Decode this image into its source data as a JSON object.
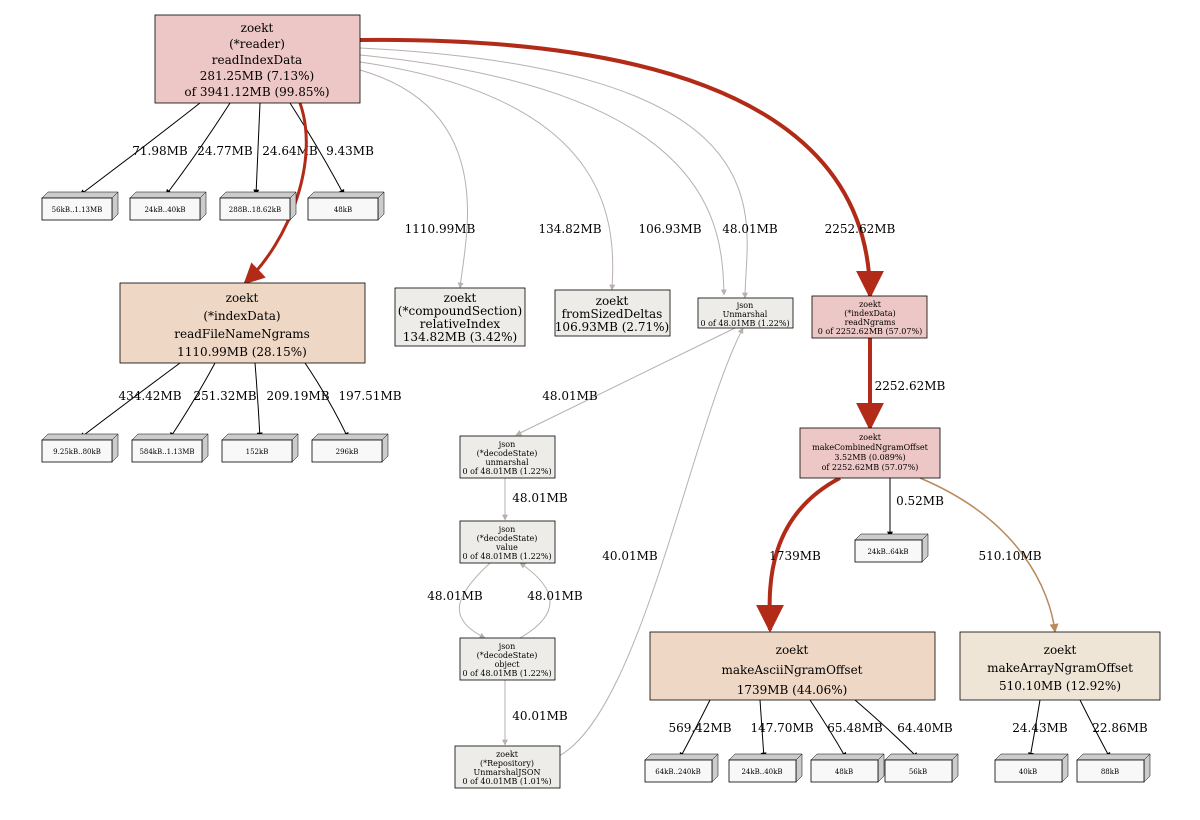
{
  "chart_data": {
    "type": "callgraph",
    "tool": "pprof",
    "root": "zoekt (*reader) readIndexData",
    "nodes": [
      {
        "id": "n1",
        "pkg": "zoekt",
        "func": "(*reader)",
        "name": "readIndexData",
        "self": "281.25MB",
        "self_pct": "7.13%",
        "cum": "3941.12MB",
        "cum_pct": "99.85%"
      },
      {
        "id": "n1a",
        "label": "56kB..1.13MB"
      },
      {
        "id": "n1b",
        "label": "24kB..40kB"
      },
      {
        "id": "n1c",
        "label": "288B..18.62kB"
      },
      {
        "id": "n1d",
        "label": "48kB"
      },
      {
        "id": "n2",
        "pkg": "zoekt",
        "func": "(*indexData)",
        "name": "readFileNameNgrams",
        "self": "1110.99MB",
        "self_pct": "28.15%"
      },
      {
        "id": "n2a",
        "label": "9.25kB..80kB"
      },
      {
        "id": "n2b",
        "label": "584kB..1.13MB"
      },
      {
        "id": "n2c",
        "label": "152kB"
      },
      {
        "id": "n2d",
        "label": "296kB"
      },
      {
        "id": "n3",
        "pkg": "zoekt",
        "func": "(*compoundSection)",
        "name": "relativeIndex",
        "self": "134.82MB",
        "self_pct": "3.42%"
      },
      {
        "id": "n4",
        "pkg": "zoekt",
        "name": "fromSizedDeltas",
        "self": "106.93MB",
        "self_pct": "2.71%"
      },
      {
        "id": "n5",
        "pkg": "json",
        "name": "Unmarshal",
        "cum": "48.01MB",
        "cum_pct": "1.22%",
        "self": "0"
      },
      {
        "id": "n6",
        "pkg": "zoekt",
        "func": "(*indexData)",
        "name": "readNgrams",
        "cum": "2252.62MB",
        "cum_pct": "57.07%",
        "self": "0"
      },
      {
        "id": "n7",
        "pkg": "json",
        "func": "(*decodeState)",
        "name": "unmarshal",
        "cum": "48.01MB",
        "cum_pct": "1.22%",
        "self": "0"
      },
      {
        "id": "n8",
        "pkg": "json",
        "func": "(*decodeState)",
        "name": "value",
        "cum": "48.01MB",
        "cum_pct": "1.22%",
        "self": "0"
      },
      {
        "id": "n9",
        "pkg": "json",
        "func": "(*decodeState)",
        "name": "object",
        "cum": "48.01MB",
        "cum_pct": "1.22%",
        "self": "0"
      },
      {
        "id": "n10",
        "pkg": "zoekt",
        "func": "(*Repository)",
        "name": "UnmarshalJSON",
        "cum": "40.01MB",
        "cum_pct": "1.01%",
        "self": "0"
      },
      {
        "id": "n11",
        "pkg": "zoekt",
        "name": "makeCombinedNgramOffset",
        "self": "3.52MB",
        "self_pct": "0.089%",
        "cum": "2252.62MB",
        "cum_pct": "57.07%"
      },
      {
        "id": "n11a",
        "label": "24kB..64kB"
      },
      {
        "id": "n12",
        "pkg": "zoekt",
        "name": "makeAsciiNgramOffset",
        "self": "1739MB",
        "self_pct": "44.06%"
      },
      {
        "id": "n12a",
        "label": "64kB..240kB"
      },
      {
        "id": "n12b",
        "label": "24kB..40kB"
      },
      {
        "id": "n12c",
        "label": "48kB"
      },
      {
        "id": "n12d",
        "label": "56kB"
      },
      {
        "id": "n13",
        "pkg": "zoekt",
        "name": "makeArrayNgramOffset",
        "self": "510.10MB",
        "self_pct": "12.92%"
      },
      {
        "id": "n13a",
        "label": "40kB"
      },
      {
        "id": "n13b",
        "label": "88kB"
      }
    ],
    "edges": [
      {
        "from": "n1",
        "to": "n1a",
        "w": "71.98MB"
      },
      {
        "from": "n1",
        "to": "n1b",
        "w": "24.77MB"
      },
      {
        "from": "n1",
        "to": "n1c",
        "w": "24.64MB"
      },
      {
        "from": "n1",
        "to": "n1d",
        "w": "9.43MB"
      },
      {
        "from": "n1",
        "to": "n2",
        "w": "1110.99MB"
      },
      {
        "from": "n1",
        "to": "n3",
        "w": "134.82MB"
      },
      {
        "from": "n1",
        "to": "n4",
        "w": "106.93MB"
      },
      {
        "from": "n1",
        "to": "n5",
        "w": "48.01MB"
      },
      {
        "from": "n1",
        "to": "n6",
        "w": "2252.62MB"
      },
      {
        "from": "n2",
        "to": "n2a",
        "w": "434.42MB"
      },
      {
        "from": "n2",
        "to": "n2b",
        "w": "251.32MB"
      },
      {
        "from": "n2",
        "to": "n2c",
        "w": "209.19MB"
      },
      {
        "from": "n2",
        "to": "n2d",
        "w": "197.51MB"
      },
      {
        "from": "n5",
        "to": "n7",
        "w": "48.01MB"
      },
      {
        "from": "n7",
        "to": "n8",
        "w": "48.01MB"
      },
      {
        "from": "n8",
        "to": "n9",
        "w": "48.01MB"
      },
      {
        "from": "n9",
        "to": "n8",
        "w": "48.01MB"
      },
      {
        "from": "n9",
        "to": "n10",
        "w": "40.01MB"
      },
      {
        "from": "n10",
        "to": "n5",
        "w": "40.01MB"
      },
      {
        "from": "n6",
        "to": "n11",
        "w": "2252.62MB"
      },
      {
        "from": "n11",
        "to": "n11a",
        "w": "0.52MB"
      },
      {
        "from": "n11",
        "to": "n12",
        "w": "1739MB"
      },
      {
        "from": "n11",
        "to": "n13",
        "w": "510.10MB"
      },
      {
        "from": "n12",
        "to": "n12a",
        "w": "569.42MB"
      },
      {
        "from": "n12",
        "to": "n12b",
        "w": "147.70MB"
      },
      {
        "from": "n12",
        "to": "n12c",
        "w": "65.48MB"
      },
      {
        "from": "n12",
        "to": "n12d",
        "w": "64.40MB"
      },
      {
        "from": "n13",
        "to": "n13a",
        "w": "24.43MB"
      },
      {
        "from": "n13",
        "to": "n13b",
        "w": "22.86MB"
      }
    ]
  },
  "nodes": {
    "n1": {
      "l1": "zoekt",
      "l2": "(*reader)",
      "l3": "readIndexData",
      "l4": "281.25MB (7.13%)",
      "l5": "of 3941.12MB (99.85%)"
    },
    "n1a": {
      "l": "56kB..1.13MB"
    },
    "n1b": {
      "l": "24kB..40kB"
    },
    "n1c": {
      "l": "288B..18.62kB"
    },
    "n1d": {
      "l": "48kB"
    },
    "n2": {
      "l1": "zoekt",
      "l2": "(*indexData)",
      "l3": "readFileNameNgrams",
      "l4": "1110.99MB (28.15%)"
    },
    "n2a": {
      "l": "9.25kB..80kB"
    },
    "n2b": {
      "l": "584kB..1.13MB"
    },
    "n2c": {
      "l": "152kB"
    },
    "n2d": {
      "l": "296kB"
    },
    "n3": {
      "l1": "zoekt",
      "l2": "(*compoundSection)",
      "l3": "relativeIndex",
      "l4": "134.82MB (3.42%)"
    },
    "n4": {
      "l1": "zoekt",
      "l2": "fromSizedDeltas",
      "l3": "106.93MB (2.71%)"
    },
    "n5": {
      "l1": "json",
      "l2": "Unmarshal",
      "l3": "0 of 48.01MB (1.22%)"
    },
    "n6": {
      "l1": "zoekt",
      "l2": "(*indexData)",
      "l3": "readNgrams",
      "l4": "0 of 2252.62MB (57.07%)"
    },
    "n7": {
      "l1": "json",
      "l2": "(*decodeState)",
      "l3": "unmarshal",
      "l4": "0 of 48.01MB (1.22%)"
    },
    "n8": {
      "l1": "json",
      "l2": "(*decodeState)",
      "l3": "value",
      "l4": "0 of 48.01MB (1.22%)"
    },
    "n9": {
      "l1": "json",
      "l2": "(*decodeState)",
      "l3": "object",
      "l4": "0 of 48.01MB (1.22%)"
    },
    "n10": {
      "l1": "zoekt",
      "l2": "(*Repository)",
      "l3": "UnmarshalJSON",
      "l4": "0 of 40.01MB (1.01%)"
    },
    "n11": {
      "l1": "zoekt",
      "l2": "makeCombinedNgramOffset",
      "l3": "3.52MB (0.089%)",
      "l4": "of 2252.62MB (57.07%)"
    },
    "n11a": {
      "l": "24kB..64kB"
    },
    "n12": {
      "l1": "zoekt",
      "l2": "makeAsciiNgramOffset",
      "l3": "1739MB (44.06%)"
    },
    "n12a": {
      "l": "64kB..240kB"
    },
    "n12b": {
      "l": "24kB..40kB"
    },
    "n12c": {
      "l": "48kB"
    },
    "n12d": {
      "l": "56kB"
    },
    "n13": {
      "l1": "zoekt",
      "l2": "makeArrayNgramOffset",
      "l3": "510.10MB (12.92%)"
    },
    "n13a": {
      "l": "40kB"
    },
    "n13b": {
      "l": "88kB"
    }
  },
  "edges": {
    "e_n1_n1a": "71.98MB",
    "e_n1_n1b": "24.77MB",
    "e_n1_n1c": "24.64MB",
    "e_n1_n1d": "9.43MB",
    "e_n1_n2": "1110.99MB",
    "e_n1_n3": "134.82MB",
    "e_n1_n4": "106.93MB",
    "e_n1_n5": "48.01MB",
    "e_n1_n6": "2252.62MB",
    "e_n2_n2a": "434.42MB",
    "e_n2_n2b": "251.32MB",
    "e_n2_n2c": "209.19MB",
    "e_n2_n2d": "197.51MB",
    "e_n5_n7": "48.01MB",
    "e_n7_n8": "48.01MB",
    "e_n8_n9": "48.01MB",
    "e_n9_n8": "48.01MB",
    "e_n9_n10": "40.01MB",
    "e_n10_n5": "40.01MB",
    "e_n6_n11": "2252.62MB",
    "e_n11_n11a": "0.52MB",
    "e_n11_n12": "1739MB",
    "e_n11_n13": "510.10MB",
    "e_n12_n12a": "569.42MB",
    "e_n12_n12b": "147.70MB",
    "e_n12_n12c": "65.48MB",
    "e_n12_n12d": "64.40MB",
    "e_n13_n13a": "24.43MB",
    "e_n13_n13b": "22.86MB"
  }
}
